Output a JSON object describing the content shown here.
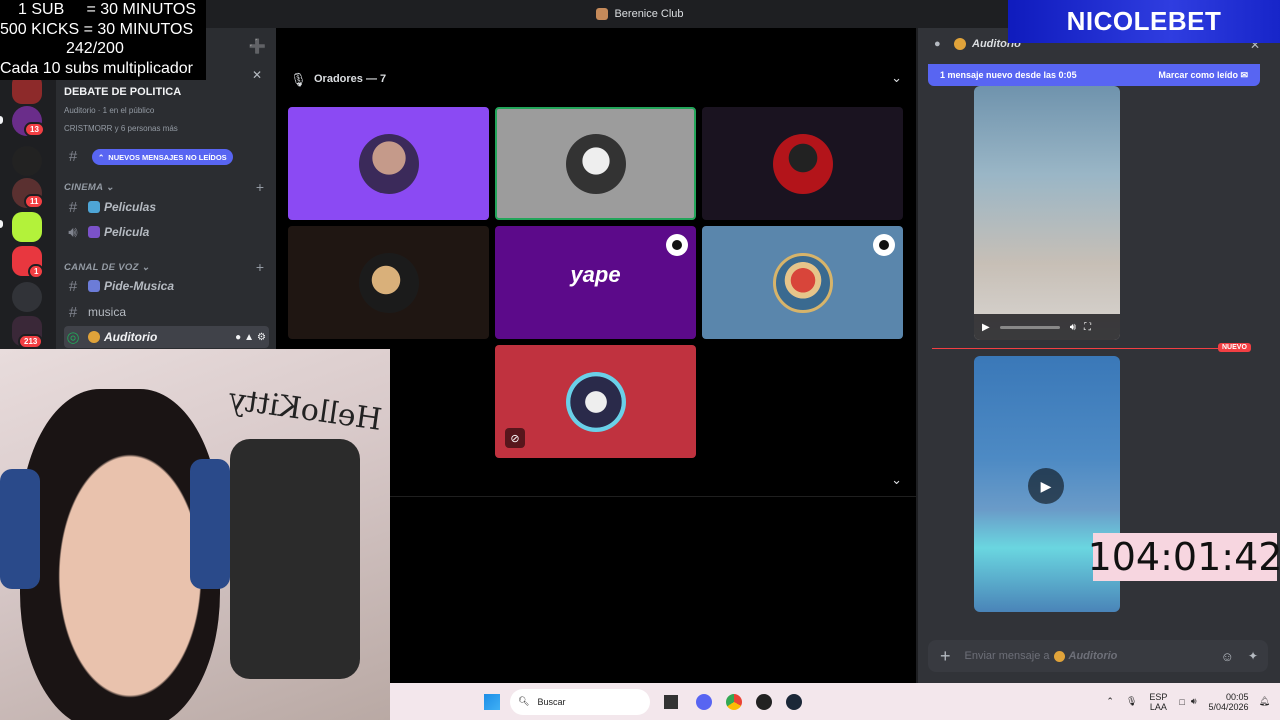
{
  "window": {
    "title": "Berenice Club"
  },
  "overlay": {
    "lines": [
      "1 SUB     = 30 MINUTOS",
      "500 KICKS = 30 MINUTOS",
      "242/200",
      "Cada 10 subs multiplicador"
    ],
    "brand": "NICOLEBET",
    "timer": "104:01:42"
  },
  "rail": {
    "badges": [
      "13",
      "11",
      "1",
      "213"
    ]
  },
  "sidebar": {
    "stage_title": "DEBATE DE POLITICA",
    "stage_sub": "Auditorio · 1 en el público",
    "stage_people": "CRISTMORR y 6 personas más",
    "unread_pill": "NUEVOS MENSAJES NO LEÍDOS",
    "cat_cinema": "CINEMA",
    "cat_voz": "CANAL DE VOZ",
    "channels": {
      "peliculas": "Peliculas",
      "pelicula": "Pelicula",
      "pide_musica": "Pide-Musica",
      "musica": "musica",
      "auditorio": "Auditorio"
    }
  },
  "stage": {
    "speakers_header": "Oradores — 7",
    "speakers": [
      {
        "bg": "#8b4af3"
      },
      {
        "bg": "#9c9c9c"
      },
      {
        "bg": "#1a1320"
      },
      {
        "bg": "#1f1612"
      },
      {
        "bg": "#5c0a8a",
        "logo": "yape"
      },
      {
        "bg": "#5a86ac"
      },
      {
        "bg": "#c0323f"
      }
    ]
  },
  "chat": {
    "channel": "Auditorio",
    "new_message": "1 mensaje nuevo desde las 0:05",
    "mark_read": "Marcar como leído",
    "new_divider": "NUEVO",
    "input_placeholder": "Enviar mensaje a",
    "input_channel": "Auditorio"
  },
  "taskbar": {
    "search": "Buscar",
    "lang": "ESP",
    "lang2": "LAA",
    "time": "00:05",
    "date": "5/04/2026"
  },
  "colors": {
    "accent": "#5865f2",
    "danger": "#f23f43",
    "speaking": "#23a55a"
  }
}
